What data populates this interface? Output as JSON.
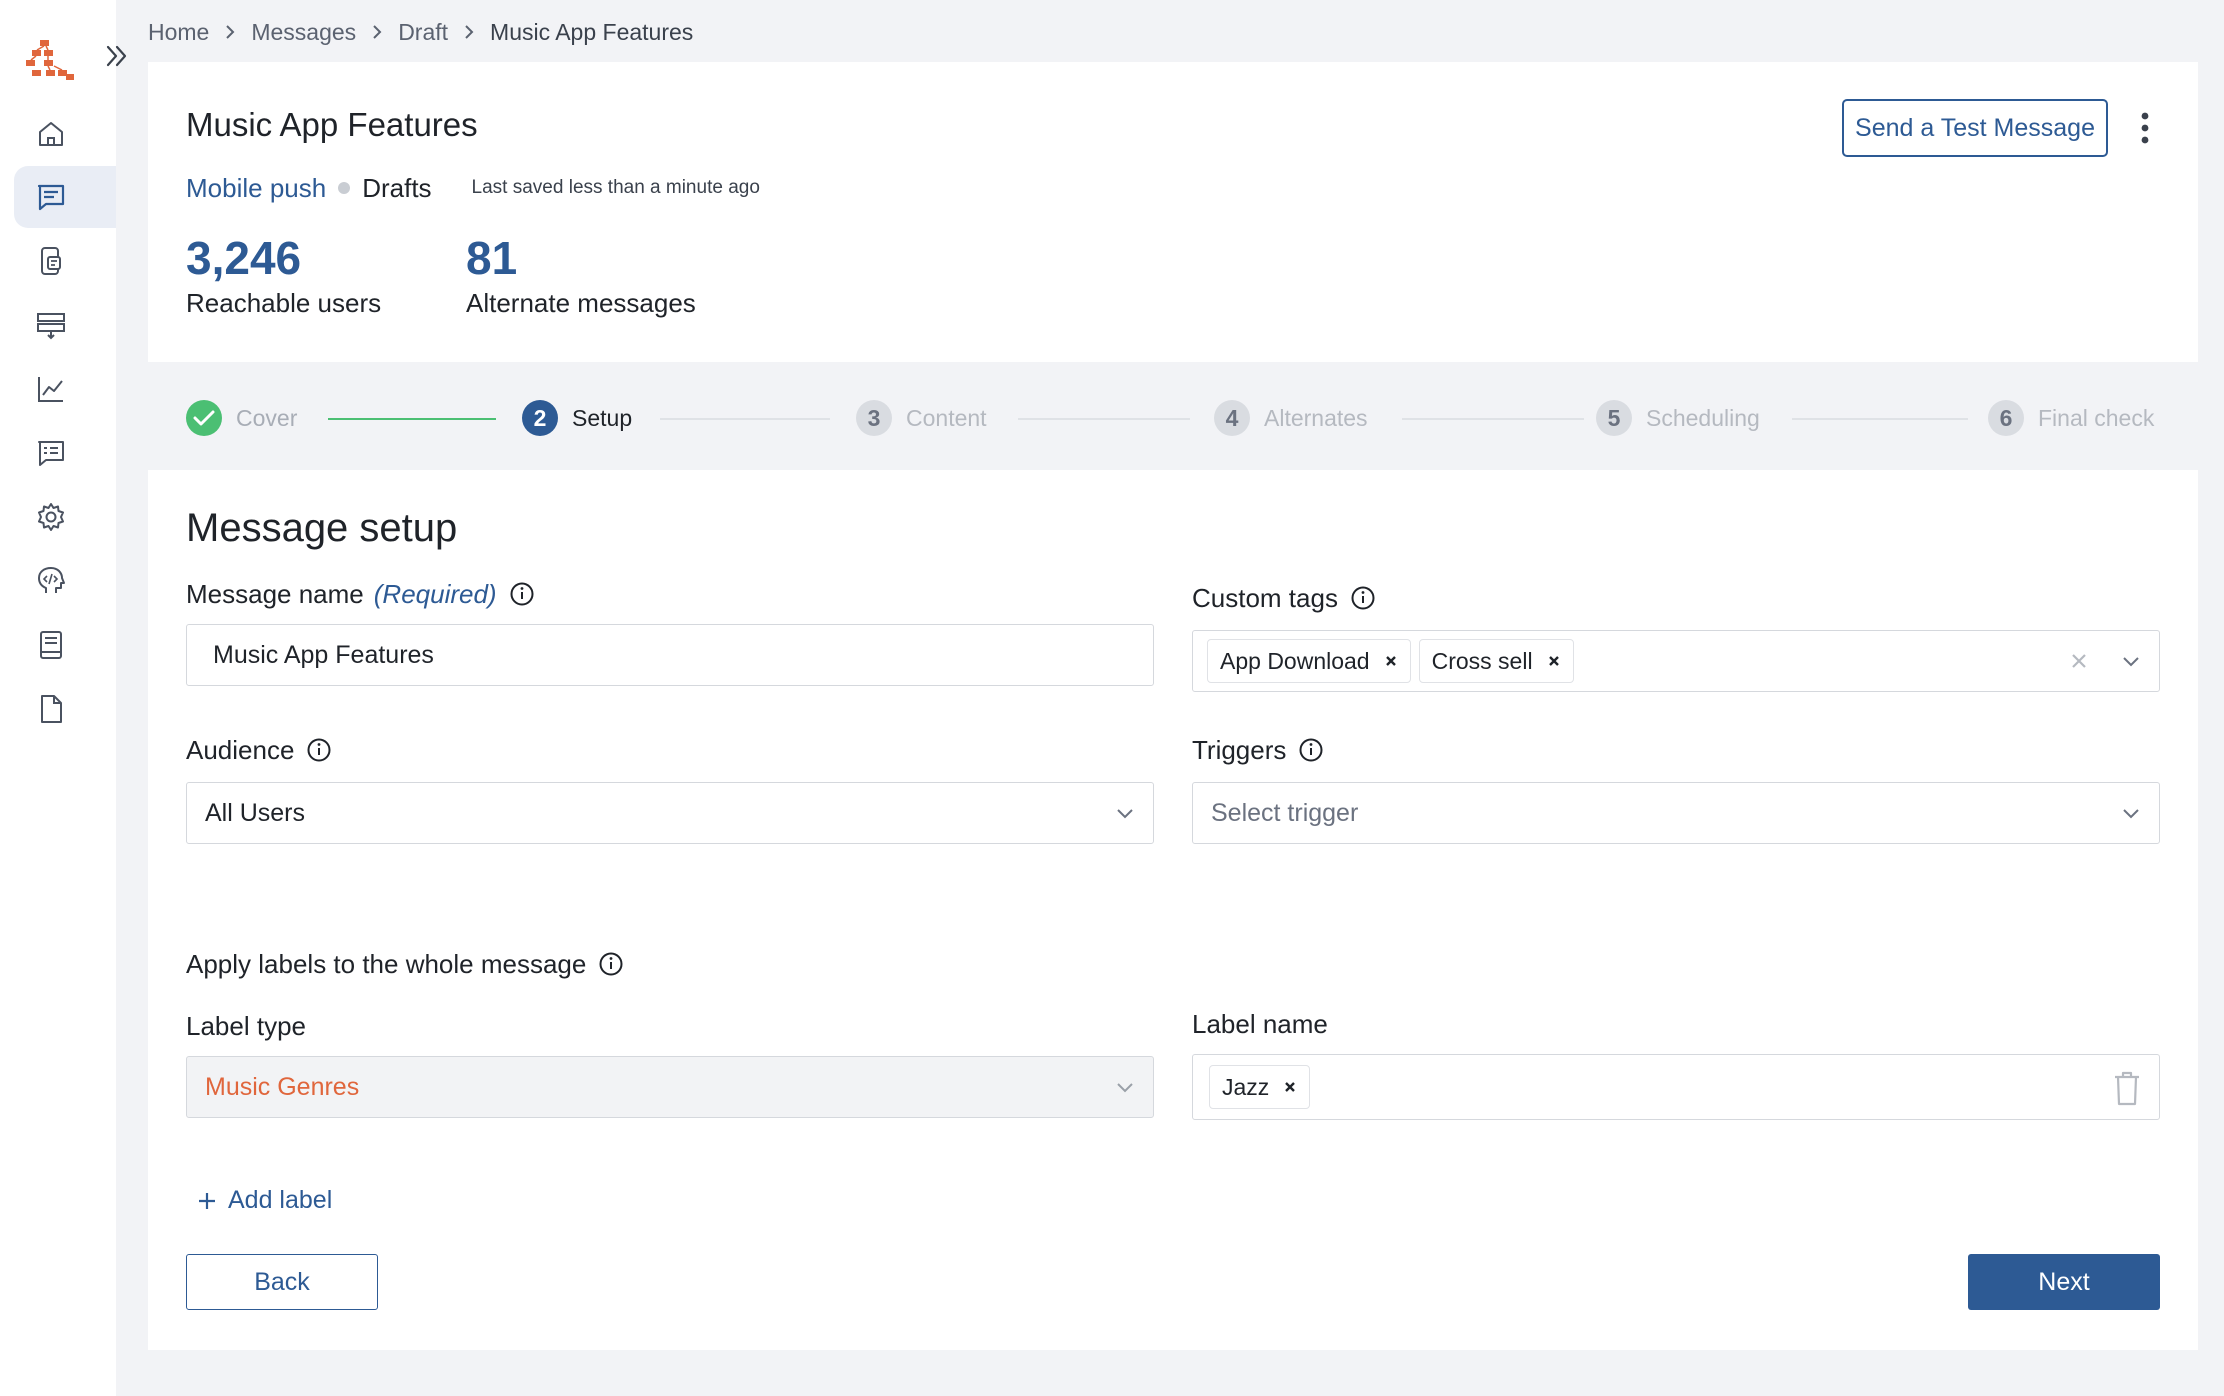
{
  "breadcrumb": [
    "Home",
    "Messages",
    "Draft",
    "Music App Features"
  ],
  "header": {
    "title": "Music App Features",
    "channel": "Mobile push",
    "status": "Drafts",
    "last_saved": "Last saved less than a minute ago",
    "stats": [
      {
        "value": "3,246",
        "label": "Reachable users"
      },
      {
        "value": "81",
        "label": "Alternate messages"
      }
    ],
    "test_button": "Send a Test Message"
  },
  "steps": [
    {
      "number": "1",
      "label": "Cover",
      "state": "done"
    },
    {
      "number": "2",
      "label": "Setup",
      "state": "current"
    },
    {
      "number": "3",
      "label": "Content",
      "state": "todo"
    },
    {
      "number": "4",
      "label": "Alternates",
      "state": "todo"
    },
    {
      "number": "5",
      "label": "Scheduling",
      "state": "todo"
    },
    {
      "number": "6",
      "label": "Final check",
      "state": "todo"
    }
  ],
  "form": {
    "section_title": "Message setup",
    "message_name": {
      "label": "Message name",
      "required": "(Required)",
      "value": "Music App Features"
    },
    "custom_tags": {
      "label": "Custom tags",
      "tags": [
        "App Download",
        "Cross sell"
      ]
    },
    "audience": {
      "label": "Audience",
      "value": "All Users"
    },
    "triggers": {
      "label": "Triggers",
      "placeholder": "Select trigger"
    },
    "apply_labels": "Apply labels to the whole message",
    "label_type": {
      "label": "Label type",
      "value": "Music Genres"
    },
    "label_name": {
      "label": "Label name",
      "tags": [
        "Jazz"
      ]
    },
    "add_label": "Add label",
    "back": "Back",
    "next": "Next"
  },
  "colors": {
    "primary": "#2d5a94",
    "success": "#4bbf73",
    "logo": "#e0663c",
    "label_value": "#e0663c"
  },
  "icons": [
    "logo-icon",
    "expand-icon",
    "home-icon",
    "messages-icon",
    "mobile-doc-icon",
    "layout-icon",
    "analytics-icon",
    "feedback-icon",
    "settings-icon",
    "developer-icon",
    "book-icon",
    "document-icon",
    "info-icon",
    "chevron-down-icon",
    "close-icon",
    "trash-icon",
    "plus-icon",
    "more-vertical-icon",
    "check-icon"
  ]
}
